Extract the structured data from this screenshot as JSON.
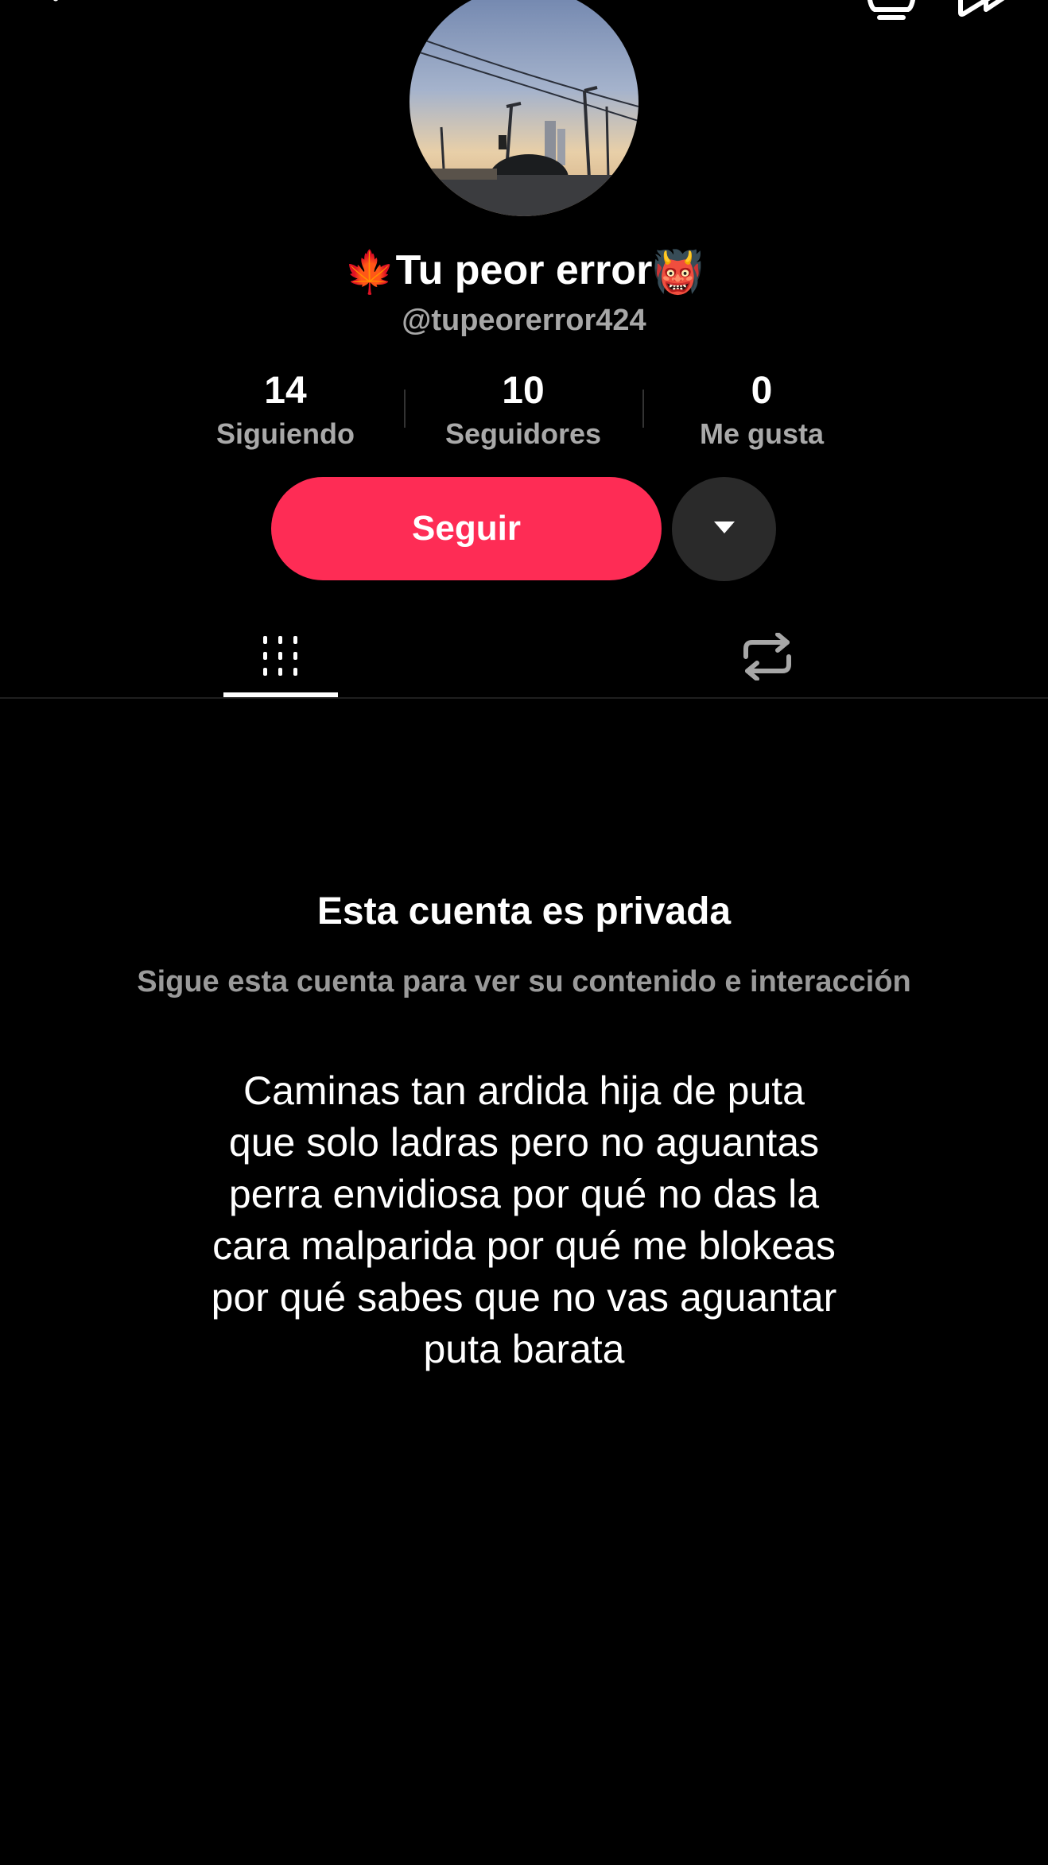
{
  "profile": {
    "display_name": "Tu peor error",
    "leading_emoji": "🍁",
    "trailing_emoji": "👹",
    "username": "@tupeorerror424"
  },
  "stats": {
    "following": {
      "count": "14",
      "label": "Siguiendo"
    },
    "followers": {
      "count": "10",
      "label": "Seguidores"
    },
    "likes": {
      "count": "0",
      "label": "Me gusta"
    }
  },
  "actions": {
    "follow_label": "Seguir"
  },
  "private_notice": {
    "title": "Esta cuenta es privada",
    "subtitle": "Sigue esta cuenta para ver su contenido e interacción"
  },
  "bio": "Caminas tan ardida hija de puta que solo ladras pero no aguantas perra envidiosa por qué no das la cara malparida por qué me blokeas por qué sabes que no vas aguantar puta barata",
  "colors": {
    "accent": "#fe2c55",
    "background": "#000000",
    "secondary_text": "#a7a7a7"
  },
  "icons": [
    "back-icon",
    "bell-icon",
    "share-icon",
    "chevron-down-icon",
    "grid-icon",
    "repost-icon"
  ]
}
